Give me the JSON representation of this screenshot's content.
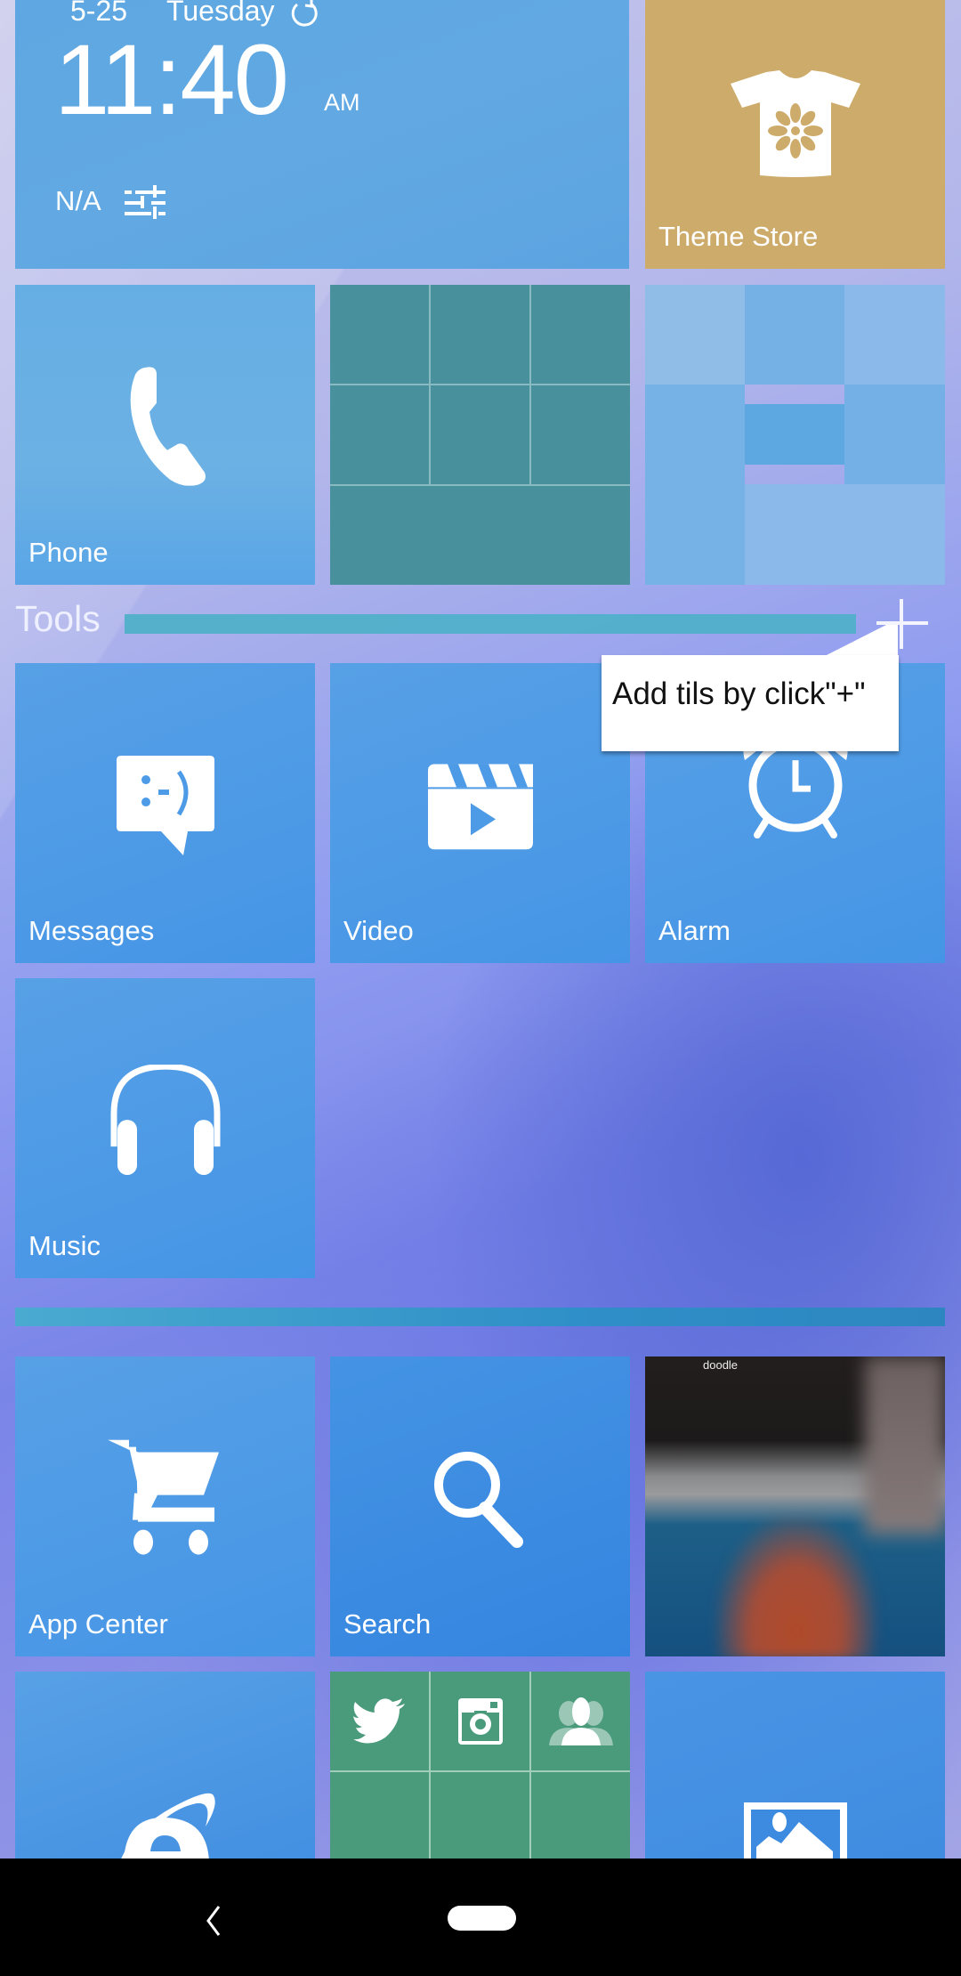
{
  "clock_widget": {
    "date": "5-25",
    "day": "Tuesday",
    "time": "11:40",
    "am_pm": "AM",
    "weather": "N/A",
    "icons": [
      "refresh-icon",
      "sliders-icon"
    ]
  },
  "tiles_top": [
    {
      "id": "theme-store",
      "label": "Theme Store",
      "icon": "tshirt-icon",
      "color": "#cdab6b"
    },
    {
      "id": "phone",
      "label": "Phone",
      "icon": "phone-icon"
    }
  ],
  "tools_section": {
    "title": "Tools",
    "add_icon": "plus-icon",
    "tooltip": "Add tils by click\"+\""
  },
  "tools_tiles": [
    {
      "id": "messages",
      "label": "Messages",
      "icon": "message-icon"
    },
    {
      "id": "video",
      "label": "Video",
      "icon": "clapperboard-icon"
    },
    {
      "id": "alarm",
      "label": "Alarm",
      "icon": "alarm-clock-icon"
    },
    {
      "id": "music",
      "label": "Music",
      "icon": "headphones-icon"
    }
  ],
  "bottom_tiles": [
    {
      "id": "app-center",
      "label": "App Center",
      "icon": "cart-icon"
    },
    {
      "id": "search",
      "label": "Search",
      "icon": "search-icon"
    },
    {
      "id": "doodle",
      "label": "doodle"
    },
    {
      "id": "browser",
      "icon": "internet-explorer-icon"
    },
    {
      "id": "social-folder",
      "icons": [
        "twitter-icon",
        "instagram-icon",
        "contacts-icon"
      ]
    },
    {
      "id": "gallery",
      "icon": "image-icon"
    }
  ],
  "colors": {
    "tile_blue": "#4595e6",
    "folder_teal": "#46909c",
    "social_green": "#4a9a7c",
    "accent_bar": "#4bb0c8"
  },
  "navbar": {
    "back": "back-icon",
    "home": "home-pill"
  }
}
